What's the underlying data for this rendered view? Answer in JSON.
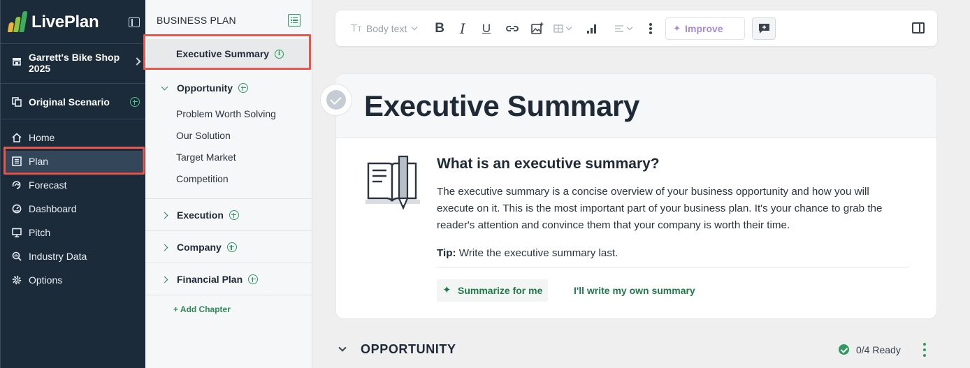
{
  "app": {
    "logo_text": "LivePlan"
  },
  "sidebar": {
    "company": "Garrett's Bike Shop 2025",
    "scenario": "Original Scenario",
    "nav": [
      {
        "label": "Home",
        "icon": "home-icon"
      },
      {
        "label": "Plan",
        "icon": "plan-icon",
        "active": true
      },
      {
        "label": "Forecast",
        "icon": "forecast-icon"
      },
      {
        "label": "Dashboard",
        "icon": "dashboard-icon"
      },
      {
        "label": "Pitch",
        "icon": "pitch-icon"
      },
      {
        "label": "Industry Data",
        "icon": "industry-data-icon"
      },
      {
        "label": "Options",
        "icon": "gear-icon"
      }
    ]
  },
  "outline": {
    "title": "BUSINESS PLAN",
    "executive_summary": "Executive Summary",
    "chapters": [
      {
        "label": "Opportunity",
        "expanded": true,
        "sections": [
          "Problem Worth Solving",
          "Our Solution",
          "Target Market",
          "Competition"
        ]
      },
      {
        "label": "Execution",
        "expanded": false
      },
      {
        "label": "Company",
        "expanded": false
      },
      {
        "label": "Financial Plan",
        "expanded": false
      }
    ],
    "add_chapter": "+ Add Chapter"
  },
  "toolbar": {
    "text_style": "Body text",
    "improve": "Improve"
  },
  "editor": {
    "title": "Executive Summary",
    "help_title": "What is an executive summary?",
    "help_body": "The executive summary is a concise overview of your business opportunity and how you will execute on it. This is the most important part of your business plan. It's your chance to grab the reader's attention and convince them that your company is worth their time.",
    "tip_label": "Tip:",
    "tip_text": " Write the executive summary last.",
    "summarize_button": "Summarize for me",
    "own_summary_link": "I'll write my own summary"
  },
  "next_section": {
    "name": "OPPORTUNITY",
    "status": "0/4 Ready"
  },
  "colors": {
    "sidebar_bg": "#1c2b3a",
    "accent_green": "#2e9a5e",
    "highlight_red": "#e8574d",
    "improve_purple": "#a58ad8"
  }
}
